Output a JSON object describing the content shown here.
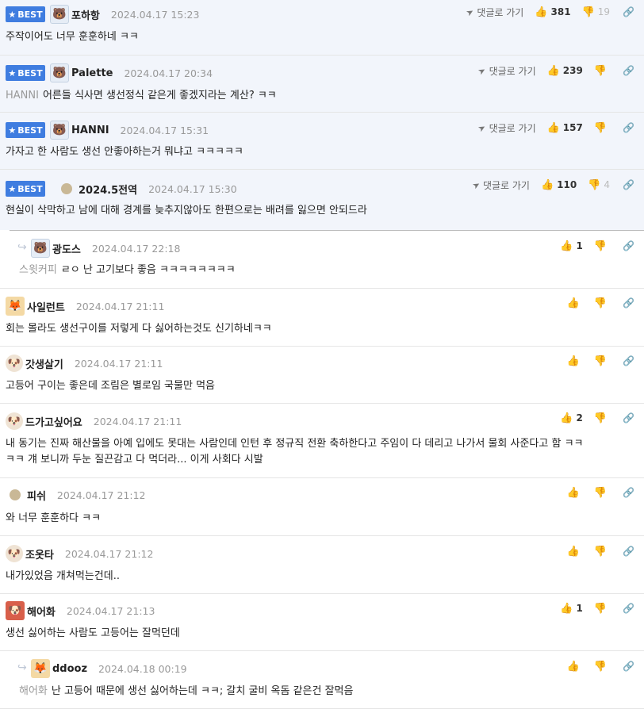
{
  "best_label": "BEST",
  "goto_label": "댓글로 가기",
  "comments": [
    {
      "nick": "포하항",
      "date": "2024.04.17 15:23",
      "text": "주작이어도 너무 훈훈하네 ㅋㅋ",
      "likes": "381",
      "dislikes": "19"
    },
    {
      "nick": "Palette",
      "date": "2024.04.17 20:34",
      "tag": "HANNI",
      "text": "어른들 식사면 생선정식 같은게 좋겠지라는 계산? ㅋㅋ",
      "likes": "239",
      "dislikes": ""
    },
    {
      "nick": "HANNI",
      "date": "2024.04.17 15:31",
      "text": "가자고 한 사람도 생선 안좋아하는거 뭐냐고 ㅋㅋㅋㅋㅋ",
      "likes": "157",
      "dislikes": ""
    },
    {
      "nick": "2024.5전역",
      "date": "2024.04.17 15:30",
      "text": "현실이 삭막하고 남에 대해 경계를 늦추지않아도 한편으로는 배려를 잃으면 안되드라",
      "likes": "110",
      "dislikes": "4"
    },
    {
      "nick": "광도스",
      "date": "2024.04.17 22:18",
      "tag": "스윗커피",
      "text": "ㄹㅇ 난 고기보다 좋음 ㅋㅋㅋㅋㅋㅋㅋㅋ",
      "likes": "1",
      "dislikes": ""
    },
    {
      "nick": "사일런트",
      "date": "2024.04.17 21:11",
      "text": "회는 몰라도 생선구이를 저렇게 다 싫어하는것도 신기하네ㅋㅋ",
      "likes": "",
      "dislikes": ""
    },
    {
      "nick": "갓생살기",
      "date": "2024.04.17 21:11",
      "text": "고등어 구이는 좋은데 조림은 별로임 국물만 먹음",
      "likes": "",
      "dislikes": ""
    },
    {
      "nick": "드가고싶어요",
      "date": "2024.04.17 21:11",
      "text": "내 동기는 진짜 해산물을 아예 입에도 못대는 사람인데 인턴 후 정규직 전환 축하한다고 주임이 다 데리고 나가서 물회 사준다고 함 ㅋㅋ",
      "text2": "ㅋㅋ 걔 보니까 두눈 질끈감고 다 먹더라... 이게 사회다 시발",
      "likes": "2",
      "dislikes": ""
    },
    {
      "nick": "피쉬",
      "date": "2024.04.17 21:12",
      "text": "와 너무 훈훈하다 ㅋㅋ",
      "likes": "",
      "dislikes": ""
    },
    {
      "nick": "조옷타",
      "date": "2024.04.17 21:12",
      "text": "내가있었음 개쳐먹는건데..",
      "likes": "",
      "dislikes": ""
    },
    {
      "nick": "해어화",
      "date": "2024.04.17 21:13",
      "text": "생선 싫어하는 사람도 고등어는 잘먹던데",
      "likes": "1",
      "dislikes": ""
    },
    {
      "nick": "ddooz",
      "date": "2024.04.18 00:19",
      "tag": "해어화",
      "text": "난 고등어 때문에 생선 싫어하는데 ㅋㅋ; 갈치 굴비 옥돔 같은건 잘먹음",
      "likes": "",
      "dislikes": ""
    }
  ]
}
